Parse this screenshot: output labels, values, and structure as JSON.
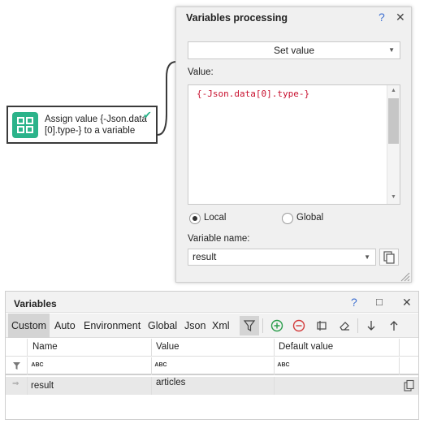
{
  "node": {
    "text_line1": "Assign value {-Json.data",
    "text_line2": "[0].type-} to a variable",
    "icon": "grid-icon",
    "status_icon": "checkmark-icon"
  },
  "processing_panel": {
    "title": "Variables processing",
    "help_label": "?",
    "close_label": "✕",
    "mode_selected": "Set value",
    "value_label": "Value:",
    "value_code": "{-Json.data[0].type-}",
    "scope_local_label": "Local",
    "scope_global_label": "Global",
    "scope_selected": "Local",
    "varname_label": "Variable name:",
    "varname_value": "result"
  },
  "variables_panel": {
    "title": "Variables",
    "help_label": "?",
    "maximize_label": "□",
    "close_label": "✕",
    "tabs": [
      "Custom",
      "Auto",
      "Environment",
      "Global",
      "Json",
      "Xml"
    ],
    "active_tab": "Custom",
    "columns": [
      "Name",
      "Value",
      "Default value"
    ],
    "filter_glyph": "ABC",
    "rows": [
      {
        "name": "result",
        "value": "articles",
        "default": ""
      }
    ]
  },
  "colors": {
    "accent_green": "#2bb38a",
    "code_red": "#c8102e",
    "help_blue": "#3d6fd1"
  }
}
